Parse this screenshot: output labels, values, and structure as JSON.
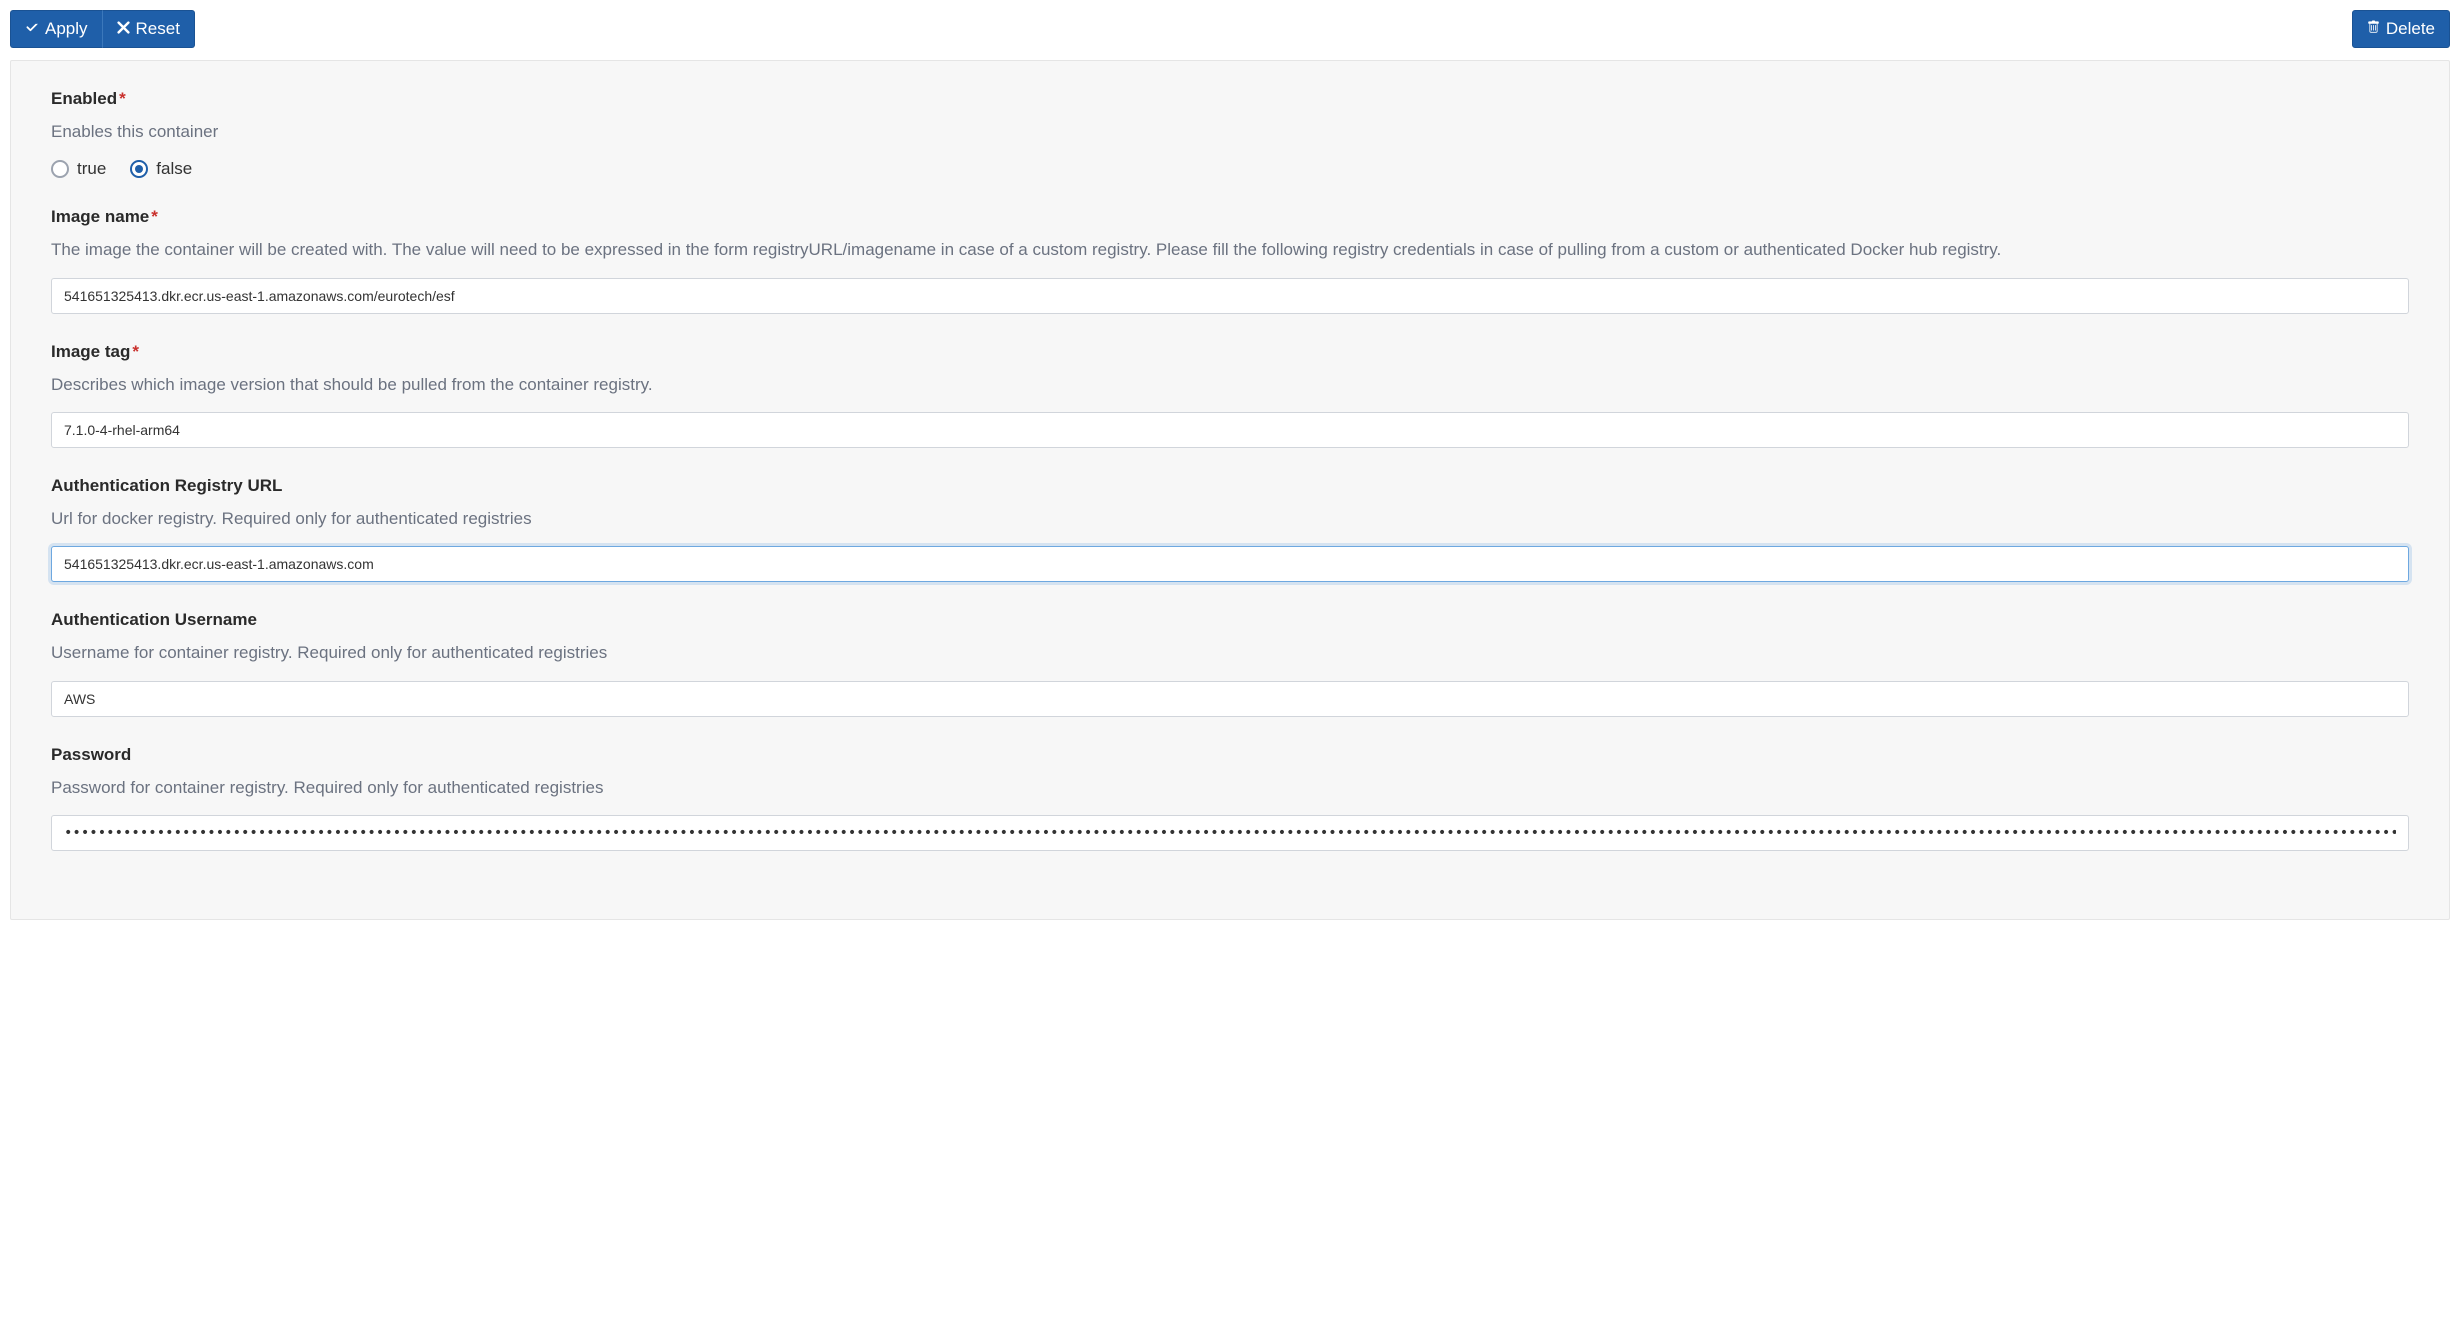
{
  "toolbar": {
    "apply_label": "Apply",
    "reset_label": "Reset",
    "delete_label": "Delete"
  },
  "form": {
    "enabled": {
      "label": "Enabled",
      "required": true,
      "help": "Enables this container",
      "option_true": "true",
      "option_false": "false",
      "selected": "false"
    },
    "image_name": {
      "label": "Image name",
      "required": true,
      "help": "The image the container will be created with. The value will need to be expressed in the form registryURL/imagename in case of a custom registry. Please fill the following registry credentials in case of pulling from a custom or authenticated Docker hub registry.",
      "value": "541651325413.dkr.ecr.us-east-1.amazonaws.com/eurotech/esf"
    },
    "image_tag": {
      "label": "Image tag",
      "required": true,
      "help": "Describes which image version that should be pulled from the container registry.",
      "value": "7.1.0-4-rhel-arm64"
    },
    "auth_registry_url": {
      "label": "Authentication Registry URL",
      "required": false,
      "help": "Url for docker registry. Required only for authenticated registries",
      "value": "541651325413.dkr.ecr.us-east-1.amazonaws.com"
    },
    "auth_username": {
      "label": "Authentication Username",
      "required": false,
      "help": "Username for container registry. Required only for authenticated registries",
      "value": "AWS"
    },
    "password": {
      "label": "Password",
      "required": false,
      "help": "Password for container registry. Required only for authenticated registries",
      "value": "•••••••••••••••••••••••••••••••••••••••••••••••••••••••••••••••••••••••••••••••••••••••••••••••••••••••••••••••••••••••••••••••••••••••••••••••••••••••••••••••••••••••••••••••••••••••••••••••••••••••••••••••••••••••••••••••••••••••••••••••••••••••••••••••••••••••••••••••••••••••••••••••••••••••••••••••••••••••••••••••••••••••••••••••••••••••••••••••••••••••••••••••••••••••••••••••••••••••••••••••••••••••••••••••••••••••••••••••••••••••••••••••••••••••••••••••••••••••••••••••••••••••••••••••••••••••••••••••••••••••••••••••••••••"
    }
  }
}
